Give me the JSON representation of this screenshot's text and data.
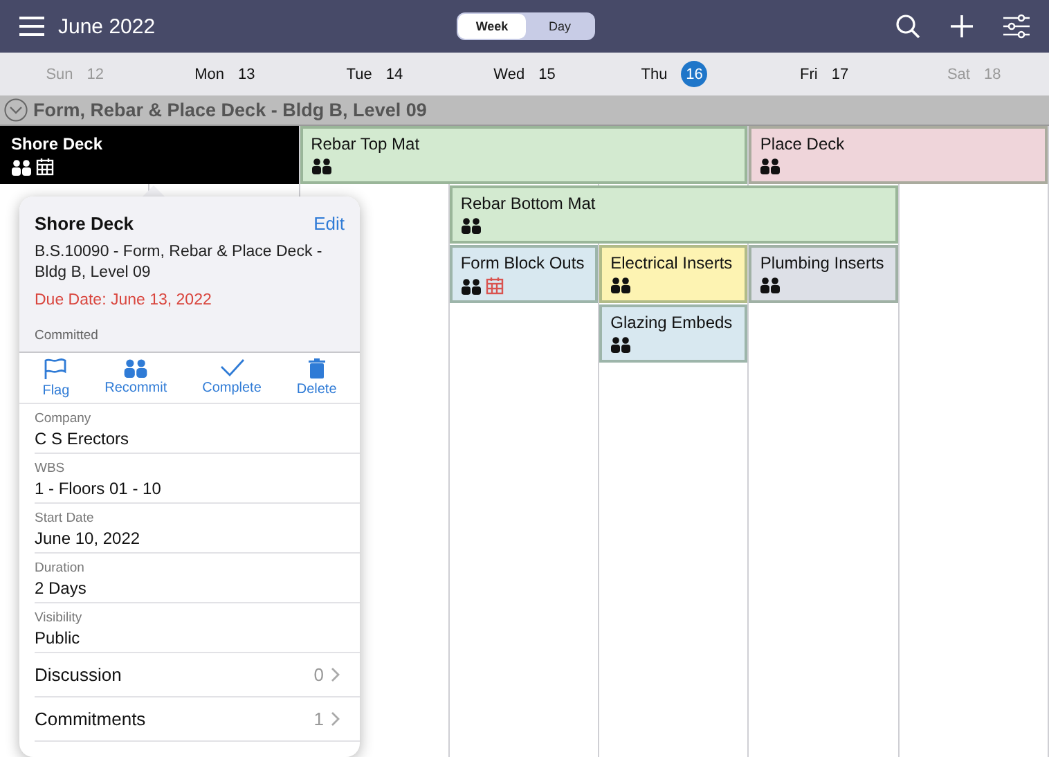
{
  "header": {
    "title": "June 2022",
    "views": [
      {
        "label": "Week",
        "selected": true
      },
      {
        "label": "Day",
        "selected": false
      }
    ]
  },
  "days": [
    {
      "name": "Sun",
      "date": "12",
      "weekend": true,
      "today": false
    },
    {
      "name": "Mon",
      "date": "13",
      "weekend": false,
      "today": false
    },
    {
      "name": "Tue",
      "date": "14",
      "weekend": false,
      "today": false
    },
    {
      "name": "Wed",
      "date": "15",
      "weekend": false,
      "today": false
    },
    {
      "name": "Thu",
      "date": "16",
      "weekend": false,
      "today": true
    },
    {
      "name": "Fri",
      "date": "17",
      "weekend": false,
      "today": false
    },
    {
      "name": "Sat",
      "date": "18",
      "weekend": true,
      "today": false
    }
  ],
  "group": {
    "title": "Form, Rebar & Place Deck - Bldg B, Level 09",
    "expanded": true
  },
  "lanes": [
    [
      {
        "title": "Shore Deck",
        "color": "#000000",
        "selected": true,
        "committed": true,
        "late": true
      },
      {
        "title": "Rebar Top Mat",
        "color": "#d3ead0",
        "selected": false,
        "committed": true,
        "late": false
      },
      {
        "title": "Place Deck",
        "color": "#efd5da",
        "selected": false,
        "committed": true,
        "late": false
      }
    ],
    [
      {
        "title": "Rebar Bottom Mat",
        "color": "#d3ead0",
        "selected": false,
        "committed": true,
        "late": false
      }
    ],
    [
      {
        "title": "Form Block Outs",
        "color": "#d8e8f0",
        "selected": false,
        "committed": true,
        "late": true
      },
      {
        "title": "Electrical Inserts",
        "color": "#fdf3b2",
        "selected": false,
        "committed": true,
        "late": false
      },
      {
        "title": "Plumbing Inserts",
        "color": "#dde0e7",
        "selected": false,
        "committed": true,
        "late": false
      }
    ],
    [
      {
        "title": "Glazing Embeds",
        "color": "#d8e8f0",
        "selected": false,
        "committed": true,
        "late": false
      }
    ]
  ],
  "popover": {
    "title": "Shore Deck",
    "edit": "Edit",
    "subtitle": "B.S.10090 - Form, Rebar & Place Deck - Bldg B, Level 09",
    "due_date": "Due Date: June 13, 2022",
    "status": "Committed",
    "actions": [
      {
        "label": "Flag",
        "kind": "flag"
      },
      {
        "label": "Recommit",
        "kind": "people"
      },
      {
        "label": "Complete",
        "kind": "check"
      },
      {
        "label": "Delete",
        "kind": "trash"
      }
    ],
    "fields": [
      {
        "label": "Company",
        "value": "C S Erectors"
      },
      {
        "label": "WBS",
        "value": "1 - Floors 01 - 10"
      },
      {
        "label": "Start Date",
        "value": "June 10, 2022"
      },
      {
        "label": "Duration",
        "value": "2 Days"
      },
      {
        "label": "Visibility",
        "value": "Public"
      }
    ],
    "links": [
      {
        "label": "Discussion",
        "count": "0"
      },
      {
        "label": "Commitments",
        "count": "1"
      }
    ]
  }
}
